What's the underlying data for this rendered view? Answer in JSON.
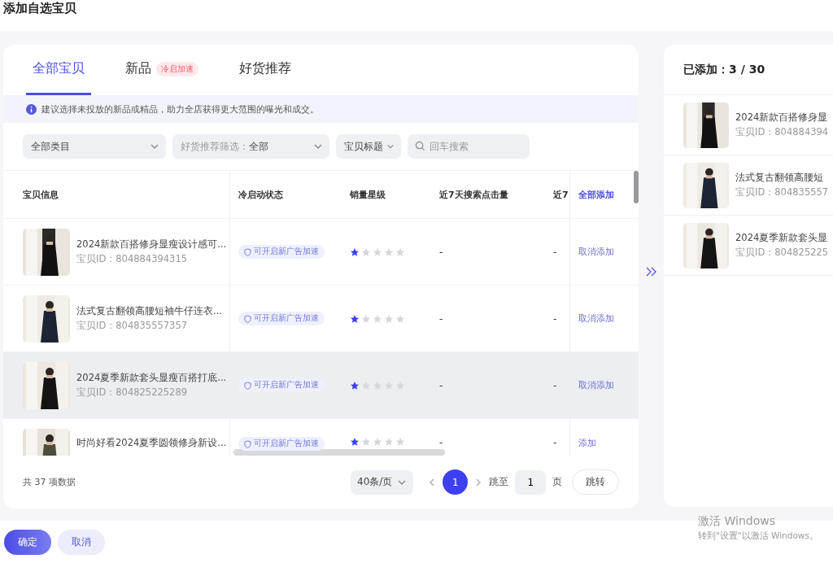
{
  "window": {
    "title": "添加自选宝贝"
  },
  "tabs": [
    {
      "label": "全部宝贝",
      "selected": true
    },
    {
      "label": "新品",
      "selected": false,
      "badge": "冷启加速"
    },
    {
      "label": "好货推荐",
      "selected": false
    }
  ],
  "notice": "建议选择未投放的新品或精品，助力全店获得更大范围的曝光和成交。",
  "filters": [
    {
      "kind": "select",
      "value": "全部类目"
    },
    {
      "kind": "select",
      "label": "好货推荐筛选：",
      "value": "全部"
    },
    {
      "kind": "select",
      "value": "宝贝标题"
    },
    {
      "kind": "search",
      "placeholder": "回车搜索"
    }
  ],
  "table": {
    "columns": [
      "宝贝信息",
      "冷启动状态",
      "销量星级",
      "近7天搜索点击量",
      "近7"
    ],
    "action_header": "全部添加",
    "rows": [
      {
        "title": "2024新款百搭修身显瘦设计感可...",
        "id": "宝贝ID：804884394315",
        "status": "可开启新广告加速",
        "stars": 1,
        "column_4": "-",
        "column_5": "-",
        "action": "取消添加",
        "hovered": false
      },
      {
        "title": "法式复古翻领高腰短袖牛仔连衣...",
        "id": "宝贝ID：804835557357",
        "status": "可开启新广告加速",
        "stars": 1,
        "column_4": "-",
        "column_5": "-",
        "action": "取消添加",
        "hovered": false
      },
      {
        "title": "2024夏季新款套头显瘦百搭打底...",
        "id": "宝贝ID：804825225289",
        "status": "可开启新广告加速",
        "stars": 1,
        "column_4": "-",
        "column_5": "-",
        "action": "取消添加",
        "hovered": true
      },
      {
        "title": "时尚好看2024夏季圆领修身新设...",
        "status": "可开启新广告加速",
        "stars": 1,
        "column_4": "-",
        "column_5": "-",
        "action": "添加",
        "hovered": false
      }
    ]
  },
  "pagination": {
    "total": "共 37 项数据",
    "page_size": "40条/页",
    "pages": [
      {
        "label": "1",
        "selected": true
      }
    ],
    "jump_label": "跳至",
    "jump_value": "1",
    "jump_unit": "页",
    "jump_button": "跳转"
  },
  "added": {
    "title": "已添加：3 / 30",
    "items": [
      {
        "title": "2024新款百搭修身显",
        "id": "宝贝ID：804884394"
      },
      {
        "title": "法式复古翻领高腰短",
        "id": "宝贝ID：804835557"
      },
      {
        "title": "2024夏季新款套头显",
        "id": "宝贝ID：804825225"
      }
    ]
  },
  "buttons": [
    {
      "label": "确定",
      "kind": "primary"
    },
    {
      "label": "取消",
      "kind": "secondary"
    }
  ],
  "os_notice": {
    "title": "激活 Windows",
    "text": "转到\"设置\"以激活 Windows。"
  }
}
